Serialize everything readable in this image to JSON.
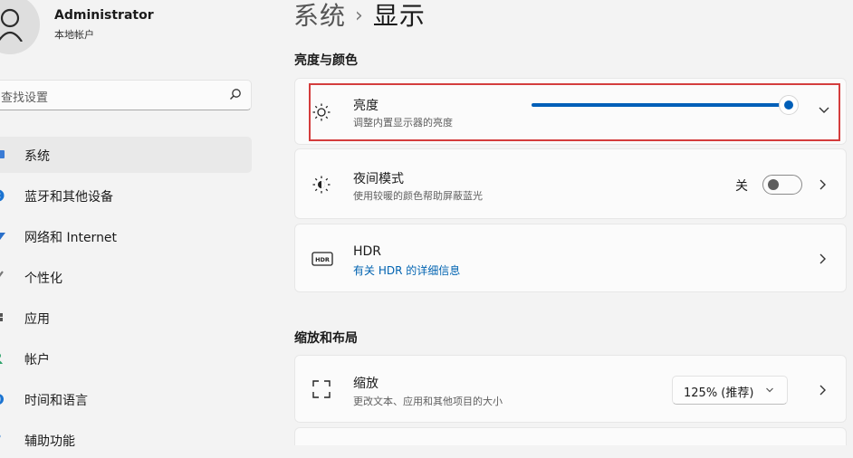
{
  "user": {
    "name": "Administrator",
    "account_type": "本地帐户"
  },
  "search": {
    "placeholder": "查找设置"
  },
  "nav": [
    {
      "label": "系统",
      "icon": "system-icon",
      "active": true
    },
    {
      "label": "蓝牙和其他设备",
      "icon": "bluetooth-icon"
    },
    {
      "label": "网络和 Internet",
      "icon": "network-icon"
    },
    {
      "label": "个性化",
      "icon": "brush-icon"
    },
    {
      "label": "应用",
      "icon": "apps-icon"
    },
    {
      "label": "帐户",
      "icon": "account-icon"
    },
    {
      "label": "时间和语言",
      "icon": "globe-icon"
    },
    {
      "label": "辅助功能",
      "icon": "accessibility-icon"
    }
  ],
  "breadcrumb": {
    "parent": "系统",
    "separator": "›",
    "current": "显示"
  },
  "sections": {
    "brightness_color": "亮度与颜色",
    "scale_layout": "缩放和布局"
  },
  "brightness": {
    "title": "亮度",
    "subtitle": "调整内置显示器的亮度",
    "value_fraction": 0.98
  },
  "night_light": {
    "title": "夜间模式",
    "subtitle": "使用较暖的颜色帮助屏蔽蓝光",
    "state_label": "关"
  },
  "hdr": {
    "title": "HDR",
    "link": "有关 HDR 的详细信息",
    "icon_text": "HDR"
  },
  "scale": {
    "title": "缩放",
    "subtitle": "更改文本、应用和其他项目的大小",
    "selected": "125% (推荐)"
  },
  "colors": {
    "accent": "#005fb8",
    "highlight": "#d43d3d",
    "link": "#0063b1"
  }
}
